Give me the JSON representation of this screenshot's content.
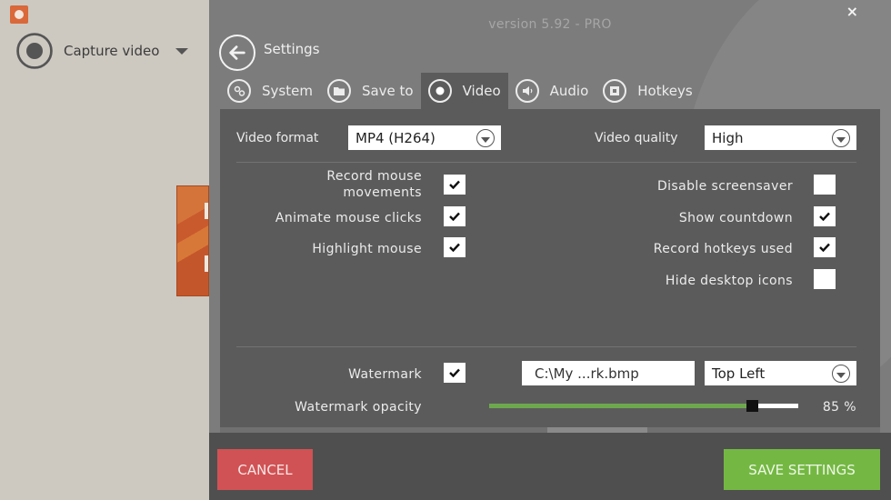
{
  "app": {
    "logo_icon": "app-logo-icon",
    "capture_mode": "Capture video",
    "capture_icon": "record-icon",
    "dropdown_icon": "caret-down-icon"
  },
  "dialog": {
    "version": "version 5.92 - PRO",
    "close_label": "×",
    "title": "Settings",
    "back_icon": "arrow-left-icon",
    "tabs": [
      {
        "label": "System",
        "icon": "gears-icon",
        "active": false
      },
      {
        "label": "Save to",
        "icon": "folder-icon",
        "active": false
      },
      {
        "label": "Video",
        "icon": "record-icon",
        "active": true
      },
      {
        "label": "Audio",
        "icon": "speaker-icon",
        "active": false
      },
      {
        "label": "Hotkeys",
        "icon": "keyboard-key-icon",
        "active": false
      }
    ]
  },
  "video": {
    "format_label": "Video format",
    "format_value": "MP4 (H264)",
    "quality_label": "Video quality",
    "quality_value": "High",
    "left_options": [
      {
        "label_line1": "Record mouse",
        "label_line2": "movements",
        "checked": true
      },
      {
        "label": "Animate mouse clicks",
        "checked": true
      },
      {
        "label": "Highlight mouse",
        "checked": true
      }
    ],
    "right_options": [
      {
        "label": "Disable screensaver",
        "checked": false
      },
      {
        "label": "Show countdown",
        "checked": true
      },
      {
        "label": "Record hotkeys used",
        "checked": true
      },
      {
        "label": "Hide desktop icons",
        "checked": false
      }
    ],
    "watermark": {
      "label": "Watermark",
      "checked": true,
      "file": "C:\\My ...rk.bmp",
      "position": "Top Left",
      "opacity_label": "Watermark opacity",
      "opacity_percent": 85,
      "opacity_text": "85 %"
    }
  },
  "footer": {
    "cancel_label": "CANCEL",
    "save_label": "SAVE SETTINGS"
  },
  "colors": {
    "cancel": "#d15254",
    "save": "#74b843",
    "slider_fill": "#6ea84e",
    "accent_orange": "#d9683a"
  }
}
